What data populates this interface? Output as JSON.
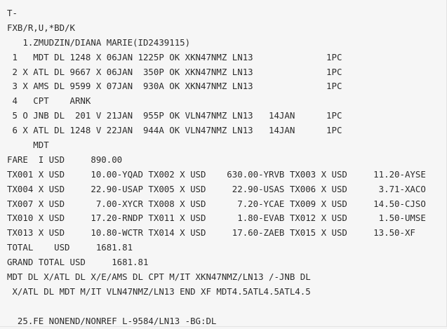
{
  "terminal": {
    "lines": [
      "T-",
      "FXB/R,U,*BD/K",
      "   1.ZMUDZIN/DIANA MARIE(ID2439115)",
      " 1   MDT DL 1248 X 06JAN 1225P OK XKN47NMZ LN13              1PC",
      " 2 X ATL DL 9667 X 06JAN  350P OK XKN47NMZ LN13              1PC",
      " 3 X AMS DL 9599 X 07JAN  930A OK XKN47NMZ LN13              1PC",
      " 4   CPT    ARNK",
      " 5 O JNB DL  201 V 21JAN  955P OK VLN47NMZ LN13   14JAN      1PC",
      " 6 X ATL DL 1248 V 22JAN  944A OK VLN47NMZ LN13   14JAN      1PC",
      "     MDT",
      "FARE  I USD     890.00",
      "TX001 X USD     10.00-YQAD TX002 X USD    630.00-YRVB TX003 X USD     11.20-AYSE",
      "TX004 X USD     22.90-USAP TX005 X USD     22.90-USAS TX006 X USD      3.71-XACO",
      "TX007 X USD      7.00-XYCR TX008 X USD      7.20-YCAE TX009 X USD     14.50-CJSO",
      "TX010 X USD     17.20-RNDP TX011 X USD      1.80-EVAB TX012 X USD      1.50-UMSE",
      "TX013 X USD     10.80-WCTR TX014 X USD     17.60-ZAEB TX015 X USD     13.50-XF",
      "TOTAL    USD     1681.81",
      "GRAND TOTAL USD     1681.81",
      "MDT DL X/ATL DL X/E/AMS DL CPT M/IT XKN47NMZ/LN13 /-JNB DL",
      " X/ATL DL MDT M/IT VLN47NMZ/LN13 END XF MDT4.5ATL4.5ATL4.5",
      "",
      "  25.FE NONEND/NONREF L-9584/LN13 -BG:DL"
    ]
  }
}
